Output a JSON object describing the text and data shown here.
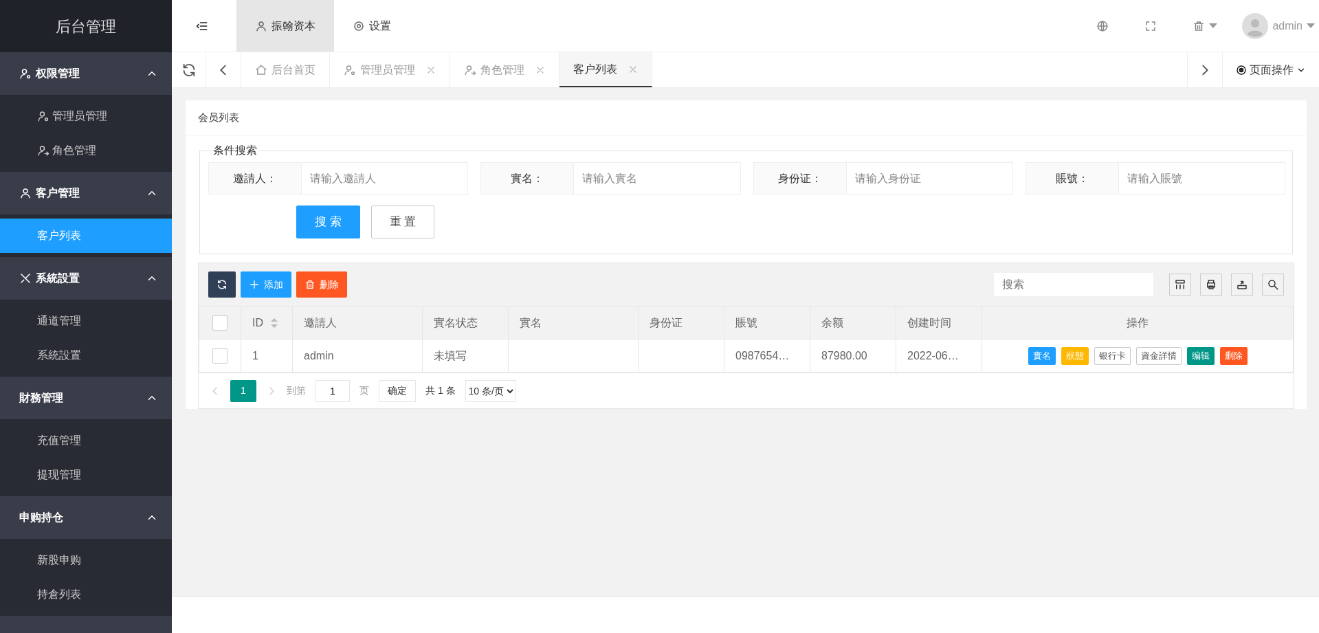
{
  "logo": "后台管理",
  "header": {
    "nav": [
      {
        "label": "振翰资本",
        "selected": true
      },
      {
        "label": "设置",
        "selected": false
      }
    ],
    "user": "admin"
  },
  "tabs": [
    {
      "label": "后台首页",
      "closable": false,
      "selected": false
    },
    {
      "label": "管理员管理",
      "closable": true,
      "selected": false
    },
    {
      "label": "角色管理",
      "closable": true,
      "selected": false
    },
    {
      "label": "客户列表",
      "closable": true,
      "selected": true
    }
  ],
  "page_actions": "页面操作",
  "sidebar": {
    "groups": [
      {
        "title": "权限管理",
        "expanded": true,
        "items": [
          {
            "label": "管理员管理",
            "selected": false
          },
          {
            "label": "角色管理",
            "selected": false
          }
        ]
      },
      {
        "title": "客户管理",
        "expanded": true,
        "items": [
          {
            "label": "客户列表",
            "selected": true
          }
        ]
      },
      {
        "title": "系統設置",
        "expanded": true,
        "items": [
          {
            "label": "通道管理",
            "selected": false
          },
          {
            "label": "系統設置",
            "selected": false
          }
        ]
      },
      {
        "title": "財務管理",
        "expanded": true,
        "items": [
          {
            "label": "充值管理",
            "selected": false
          },
          {
            "label": "提现管理",
            "selected": false
          }
        ]
      },
      {
        "title": "申购持仓",
        "expanded": true,
        "items": [
          {
            "label": "新股申购",
            "selected": false
          },
          {
            "label": "持倉列表",
            "selected": false
          }
        ]
      }
    ]
  },
  "card_title": "会员列表",
  "search": {
    "legend": "条件搜索",
    "fields": [
      {
        "label": "邀請人：",
        "placeholder": "请输入邀請人"
      },
      {
        "label": "實名：",
        "placeholder": "请输入實名"
      },
      {
        "label": "身份证：",
        "placeholder": "请输入身份证"
      },
      {
        "label": "賬號：",
        "placeholder": "请输入賬號"
      }
    ],
    "buttons": [
      {
        "label": "搜 索",
        "kind": "primary"
      },
      {
        "label": "重 置",
        "kind": "plain"
      }
    ]
  },
  "toolbar": {
    "buttons": [
      {
        "kind": "refresh"
      },
      {
        "label": "添加",
        "kind": "add"
      },
      {
        "label": "删除",
        "kind": "delete"
      }
    ],
    "search_placeholder": "搜索"
  },
  "table": {
    "header_checked": false,
    "columns": [
      {
        "label": "ID",
        "sortable": true
      },
      {
        "label": "邀請人",
        "sortable": false
      },
      {
        "label": "實名状态",
        "sortable": false
      },
      {
        "label": "實名",
        "sortable": false
      },
      {
        "label": "身份证",
        "sortable": false
      },
      {
        "label": "賬號",
        "sortable": false
      },
      {
        "label": "余额",
        "sortable": false
      },
      {
        "label": "创建时间",
        "sortable": false
      },
      {
        "label": "操作",
        "sortable": false
      }
    ],
    "rows": [
      {
        "checked": false,
        "cells": [
          "1",
          "admin",
          "未填写",
          "",
          "",
          "0987654…",
          "87980.00",
          "2022-06…"
        ],
        "actions": [
          {
            "label": "實名",
            "kind": "blue"
          },
          {
            "label": "狀態",
            "kind": "yellow"
          },
          {
            "label": "银行卡",
            "kind": "outline"
          },
          {
            "label": "資金詳情",
            "kind": "outline"
          },
          {
            "label": "编辑",
            "kind": "green"
          },
          {
            "label": "删除",
            "kind": "red"
          }
        ]
      }
    ]
  },
  "pager": {
    "current": "1",
    "goto": "到第",
    "page_value": "1",
    "page_unit": "页",
    "confirm": "确定",
    "total": "共 1 条",
    "page_size": "10 条/页"
  }
}
